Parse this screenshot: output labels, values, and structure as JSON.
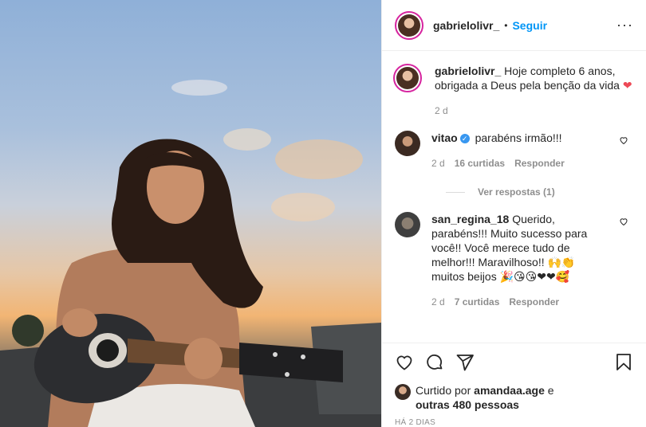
{
  "photo": {
    "alt": ""
  },
  "header": {
    "username": "gabrielolivr_",
    "separator": "•",
    "follow_label": "Seguir",
    "more_label": "···"
  },
  "caption": {
    "username": "gabrielolivr_",
    "text": "Hoje completo 6 anos, obrigada a Deus pela benção da vida",
    "emoji": "❤",
    "time": "2 d"
  },
  "comments": [
    {
      "username": "vitao",
      "verified": true,
      "text": "parabéns irmão!!!",
      "time": "2 d",
      "likes": "16 curtidas",
      "reply_label": "Responder",
      "view_replies": "Ver respostas (1)"
    },
    {
      "username": "san_regina_18",
      "text": "Querido, parabéns!!! Muito sucesso para você!! Você merece tudo de melhor!!! Maravilhoso!! 🙌👏 muitos beijos 🎉😘😘❤❤🥰",
      "time": "2 d",
      "likes": "7 curtidas",
      "reply_label": "Responder"
    }
  ],
  "actions": {
    "liked_prefix": "Curtido por",
    "liked_user": "amandaa.age",
    "liked_and": "e",
    "liked_others": "outras 480 pessoas",
    "timestamp": "HÁ 2 DIAS"
  },
  "icons": {
    "like": "heart-outline-icon",
    "comment": "comment-bubble-icon",
    "share": "paper-plane-icon",
    "save": "bookmark-icon",
    "comment_like": "small-heart-icon"
  }
}
